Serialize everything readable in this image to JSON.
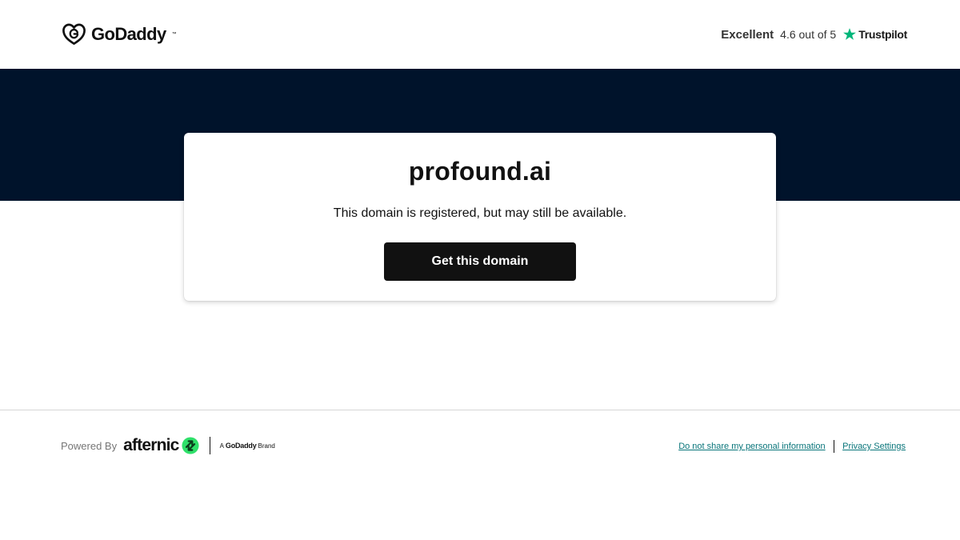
{
  "header": {
    "logo_text": "GoDaddy",
    "logo_icon": "godaddy-heart-logo",
    "rating": {
      "word": "Excellent",
      "score_text": "4.6 out of 5",
      "provider": "Trustpilot",
      "provider_icon": "trustpilot-star-icon",
      "provider_color": "#00b67a"
    }
  },
  "hero": {
    "background_color": "#00132b"
  },
  "card": {
    "domain": "profound.ai",
    "status": "This domain is registered, but may still be available.",
    "cta_label": "Get this domain"
  },
  "footer": {
    "powered_by_label": "Powered By",
    "brand_name": "afternic",
    "brand_icon": "afternic-arrows-icon",
    "brand_accent": "#2fe06a",
    "brand_tag_prefix": "A",
    "brand_tag_company": "GoDaddy",
    "brand_tag_suffix": "Brand",
    "links": [
      {
        "label": "Do not share my personal information"
      },
      {
        "label": "Privacy Settings"
      }
    ],
    "link_color": "#09757a"
  }
}
